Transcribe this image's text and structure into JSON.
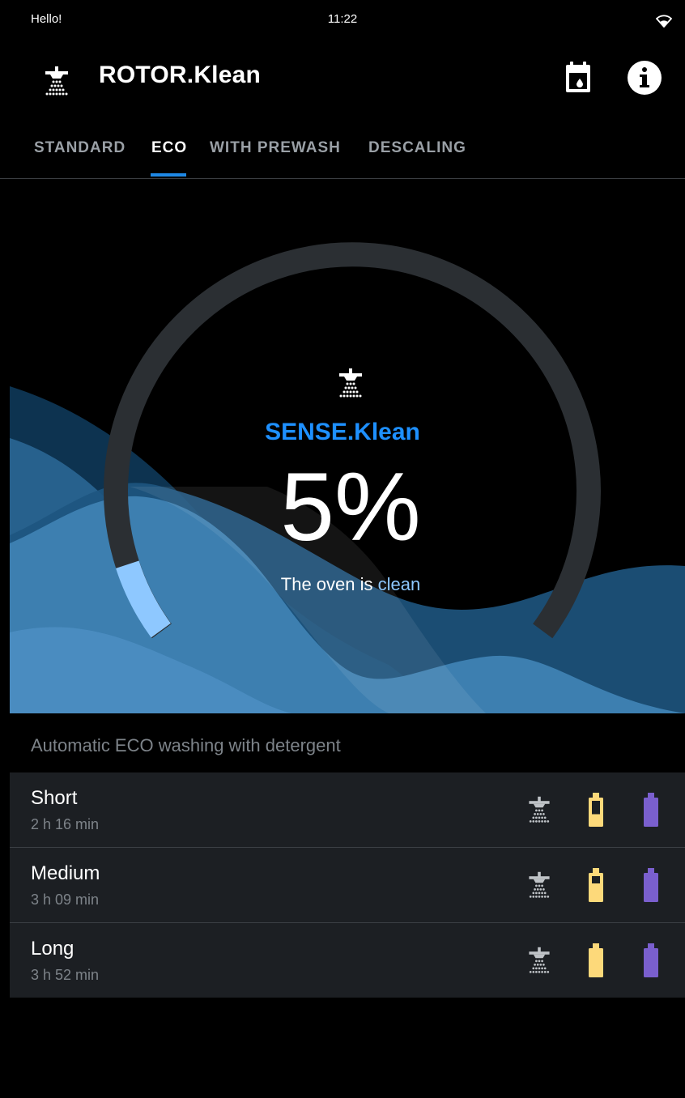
{
  "status_bar": {
    "left_text": "Hello!",
    "time": "11:22"
  },
  "app": {
    "title": "ROTOR.Klean"
  },
  "icons": {
    "app_logo": "shower-icon",
    "calendar": "calendar-icon",
    "info": "info-icon",
    "wifi": "wifi-icon"
  },
  "tabs": [
    {
      "label": "STANDARD",
      "active": false
    },
    {
      "label": "ECO",
      "active": true
    },
    {
      "label": "WITH PREWASH",
      "active": false
    },
    {
      "label": "DESCALING",
      "active": false
    }
  ],
  "gauge": {
    "title": "SENSE.Klean",
    "value_text": "5%",
    "value_fraction": 0.05,
    "status_prefix": "The oven is",
    "status_value": "clean"
  },
  "section": {
    "title": "Automatic ECO washing with detergent"
  },
  "programs": [
    {
      "name": "Short",
      "duration": "2 h 16 min",
      "detergent_fill": 0.45,
      "care_fill": 1.0
    },
    {
      "name": "Medium",
      "duration": "3 h 09 min",
      "detergent_fill": 0.7,
      "care_fill": 1.0
    },
    {
      "name": "Long",
      "duration": "3 h 52 min",
      "detergent_fill": 1.0,
      "care_fill": 1.0
    }
  ],
  "colors": {
    "accent": "#1e90ff",
    "detergent": "#fdd97a",
    "care": "#7a5fce",
    "gauge_track": "#2b2f33",
    "gauge_fill": "#8ec8ff"
  }
}
